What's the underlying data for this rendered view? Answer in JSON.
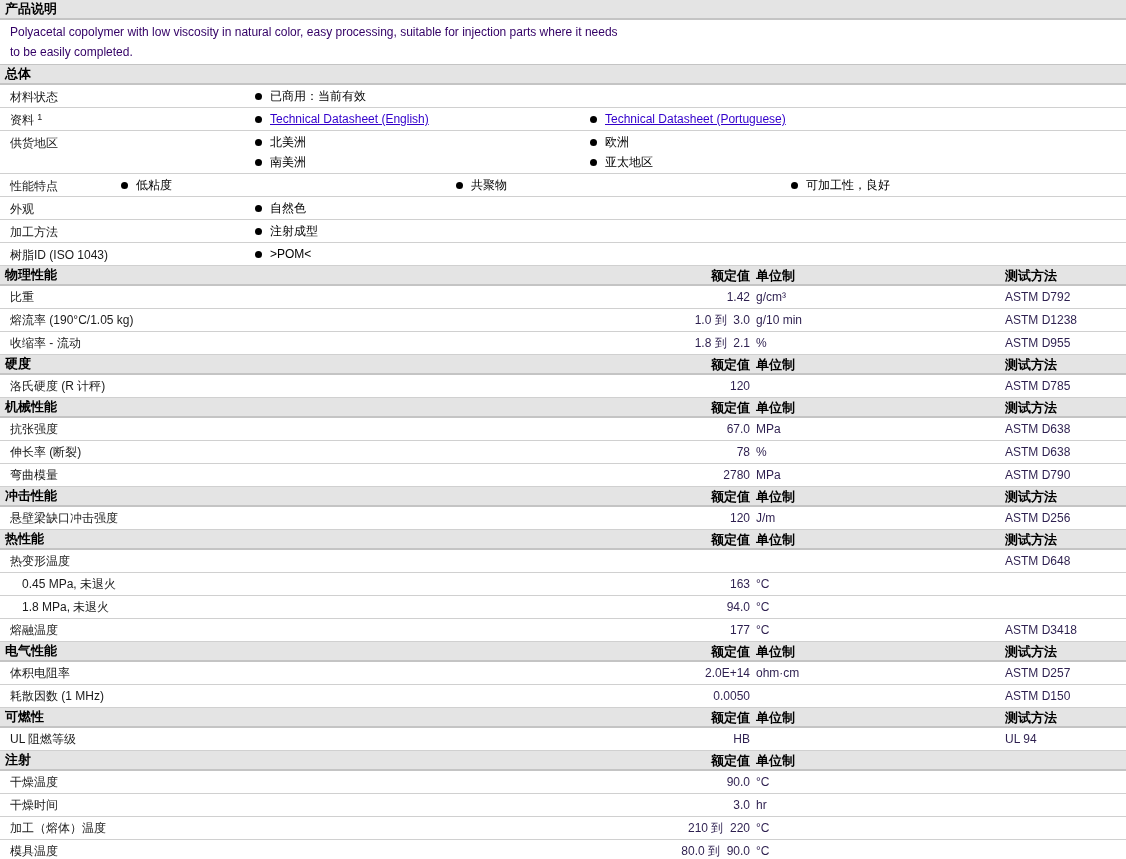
{
  "sections": [
    {
      "kind": "text",
      "title": "产品说明",
      "lines": [
        "Polyacetal copolymer with low viscosity in natural color, easy processing, suitable for injection parts where it needs",
        "to be easily completed."
      ]
    },
    {
      "kind": "list",
      "title": "总体",
      "rows": [
        {
          "label": "材料状态",
          "lines": [
            [
              {
                "kind": "text",
                "text": "已商用：当前有效"
              }
            ]
          ]
        },
        {
          "label": "资料 $^{1}$",
          "lines": [
            [
              {
                "kind": "link",
                "text": "Technical Datasheet (English)"
              },
              {
                "kind": "link",
                "text": "Technical Datasheet (Portuguese)"
              }
            ]
          ]
        },
        {
          "label": "供货地区",
          "lines": [
            [
              {
                "kind": "text",
                "text": "北美洲"
              },
              {
                "kind": "text",
                "text": "欧洲"
              }
            ],
            [
              {
                "kind": "text",
                "text": "南美洲"
              },
              {
                "kind": "text",
                "text": "亚太地区"
              }
            ]
          ]
        },
        {
          "label": "性能特点",
          "lines": [
            [
              {
                "kind": "text",
                "text": "低粘度"
              },
              {
                "kind": "text",
                "text": "共聚物"
              },
              {
                "kind": "text",
                "text": "可加工性，良好"
              }
            ]
          ]
        },
        {
          "label": "外观",
          "lines": [
            [
              {
                "kind": "text",
                "text": "自然色"
              }
            ]
          ]
        },
        {
          "label": "加工方法",
          "lines": [
            [
              {
                "kind": "text",
                "text": "注射成型"
              }
            ]
          ]
        },
        {
          "label": "树脂ID (ISO 1043)",
          "lines": [
            [
              {
                "kind": "text",
                "text": ">POM<"
              }
            ]
          ]
        }
      ]
    },
    {
      "kind": "table",
      "title": "物理性能",
      "headings": {
        "value": "额定值",
        "unit": "单位制",
        "method": "测试方法"
      },
      "rows": [
        {
          "label": "比重",
          "value": "1.42",
          "unit": "g/cm³",
          "method": "ASTM D792"
        },
        {
          "label": "熔流率 (190°C/1.05 kg)",
          "value": "1.0 到  3.0",
          "unit": "g/10 min",
          "method": "ASTM D1238"
        },
        {
          "label": "收缩率 - 流动",
          "value": "1.8 到  2.1",
          "unit": "%",
          "method": "ASTM D955"
        }
      ]
    },
    {
      "kind": "table",
      "title": "硬度",
      "headings": {
        "value": "额定值",
        "unit": "单位制",
        "method": "测试方法"
      },
      "rows": [
        {
          "label": "洛氏硬度 (R 计秤)",
          "value": "120",
          "method": "ASTM D785"
        }
      ]
    },
    {
      "kind": "table",
      "title": "机械性能",
      "headings": {
        "value": "额定值",
        "unit": "单位制",
        "method": "测试方法"
      },
      "rows": [
        {
          "label": "抗张强度",
          "value": "67.0",
          "unit": "MPa",
          "method": "ASTM D638"
        },
        {
          "label": "伸长率 (断裂)",
          "value": "78",
          "unit": "%",
          "method": "ASTM D638"
        },
        {
          "label": "弯曲模量",
          "value": "2780",
          "unit": "MPa",
          "method": "ASTM D790"
        }
      ]
    },
    {
      "kind": "table",
      "title": "冲击性能",
      "headings": {
        "value": "额定值",
        "unit": "单位制",
        "method": "测试方法"
      },
      "rows": [
        {
          "label": "悬壁梁缺口冲击强度",
          "value": "120",
          "unit": "J/m",
          "method": "ASTM D256"
        }
      ]
    },
    {
      "kind": "table",
      "title": "热性能",
      "headings": {
        "value": "额定值",
        "unit": "单位制",
        "method": "测试方法"
      },
      "rows": [
        {
          "label": "热变形温度",
          "method": "ASTM D648",
          "children": [
            {
              "label": "0.45 MPa, 未退火",
              "value": "163",
              "unit": "°C"
            },
            {
              "label": "1.8 MPa, 未退火",
              "value": "94.0",
              "unit": "°C"
            }
          ]
        },
        {
          "label": "熔融温度",
          "value": "177",
          "unit": "°C",
          "method": "ASTM D3418"
        }
      ]
    },
    {
      "kind": "table",
      "title": "电气性能",
      "headings": {
        "value": "额定值",
        "unit": "单位制",
        "method": "测试方法"
      },
      "rows": [
        {
          "label": "体积电阻率",
          "value": "2.0E+14",
          "unit": "ohm·cm",
          "method": "ASTM D257"
        },
        {
          "label": "耗散因数 (1 MHz)",
          "value": "0.0050",
          "method": "ASTM D150"
        }
      ]
    },
    {
      "kind": "table",
      "title": "可燃性",
      "headings": {
        "value": "额定值",
        "unit": "单位制",
        "method": "测试方法"
      },
      "rows": [
        {
          "label": "UL 阻燃等级",
          "value": "HB",
          "method": "UL 94"
        }
      ]
    },
    {
      "kind": "table",
      "title": "注射",
      "headings": {
        "value": "额定值",
        "unit": "单位制"
      },
      "rows": [
        {
          "label": "干燥温度",
          "value": "90.0",
          "unit": "°C"
        },
        {
          "label": "干燥时间",
          "value": "3.0",
          "unit": "hr"
        },
        {
          "label": "加工（熔体）温度",
          "value": "210 到  220",
          "unit": "°C"
        },
        {
          "label": "模具温度",
          "value": "80.0 到  90.0",
          "unit": "°C"
        }
      ]
    }
  ]
}
